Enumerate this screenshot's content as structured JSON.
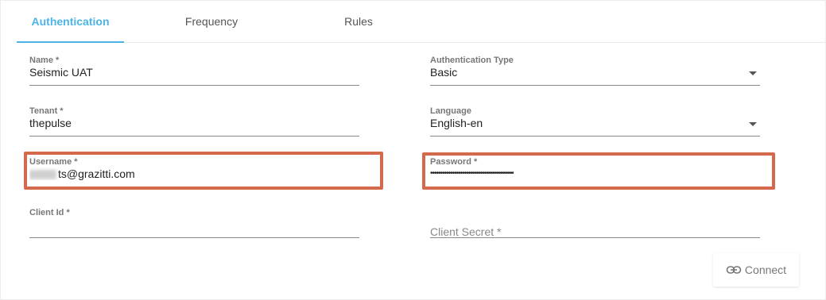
{
  "tabs": {
    "authentication": "Authentication",
    "frequency": "Frequency",
    "rules": "Rules"
  },
  "form": {
    "name": {
      "label": "Name *",
      "value": "Seismic UAT"
    },
    "auth_type": {
      "label": "Authentication Type",
      "value": "Basic"
    },
    "tenant": {
      "label": "Tenant *",
      "value": "thepulse"
    },
    "language": {
      "label": "Language",
      "value": "English-en"
    },
    "username": {
      "label": "Username *",
      "value": "ts@grazitti.com"
    },
    "password": {
      "label": "Password *",
      "value": "••••••••••••••••••••••••••••••••••••••••••"
    },
    "client_id": {
      "label": "Client Id *",
      "value": ""
    },
    "client_secret": {
      "placeholder": "Client Secret *"
    }
  },
  "actions": {
    "connect_label": "Connect",
    "connect_icon": "link-icon"
  },
  "colors": {
    "accent": "#4cb4e8",
    "highlight": "#d4694b"
  }
}
